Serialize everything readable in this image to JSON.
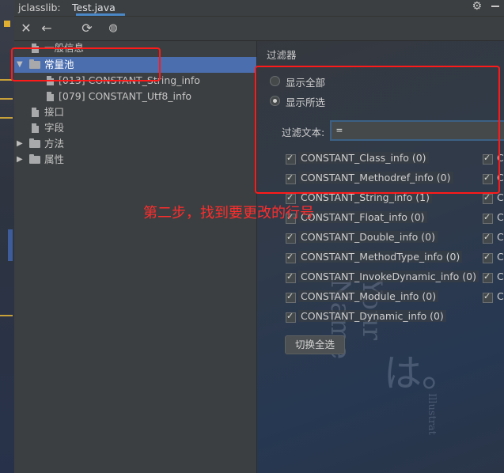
{
  "tabs": {
    "plugin": "jclasslib:",
    "file": "Test.java"
  },
  "toolbar": {
    "close": "✕",
    "back": "←",
    "refresh": "⟳",
    "browser": "🌐"
  },
  "tree": {
    "general": "一般信息",
    "constant_pool": "常量池",
    "const1": "[013] CONSTANT_String_info",
    "const2": "[079] CONSTANT_Utf8_info",
    "interfaces": "接口",
    "fields": "字段",
    "methods": "方法",
    "attributes": "属性"
  },
  "filter": {
    "title": "过滤器",
    "show_all": "显示全部",
    "show_selected": "显示所选",
    "selected_option": "显示所选",
    "text_label": "过滤文本:",
    "text_value": "=",
    "checkboxes": [
      "CONSTANT_Class_info (0)",
      "CONSTANT_Methodref_info (0)",
      "CONSTANT_String_info (1)",
      "CONSTANT_Float_info (0)",
      "CONSTANT_Double_info (0)",
      "CONSTANT_MethodType_info (0)",
      "CONSTANT_InvokeDynamic_info (0)",
      "CONSTANT_Module_info (0)",
      "CONSTANT_Dynamic_info (0)"
    ],
    "second_col_partial": "C",
    "toggle_all": "切换全选"
  },
  "annotation": "第二步，找到要更改的行号",
  "background_art": {
    "text1": "Your Name",
    "text2": "は。",
    "text3": "Illustrat"
  },
  "colors": {
    "selection": "#4b6eaf",
    "annotation": "#ff1a1a",
    "panel": "#3c3f41"
  }
}
